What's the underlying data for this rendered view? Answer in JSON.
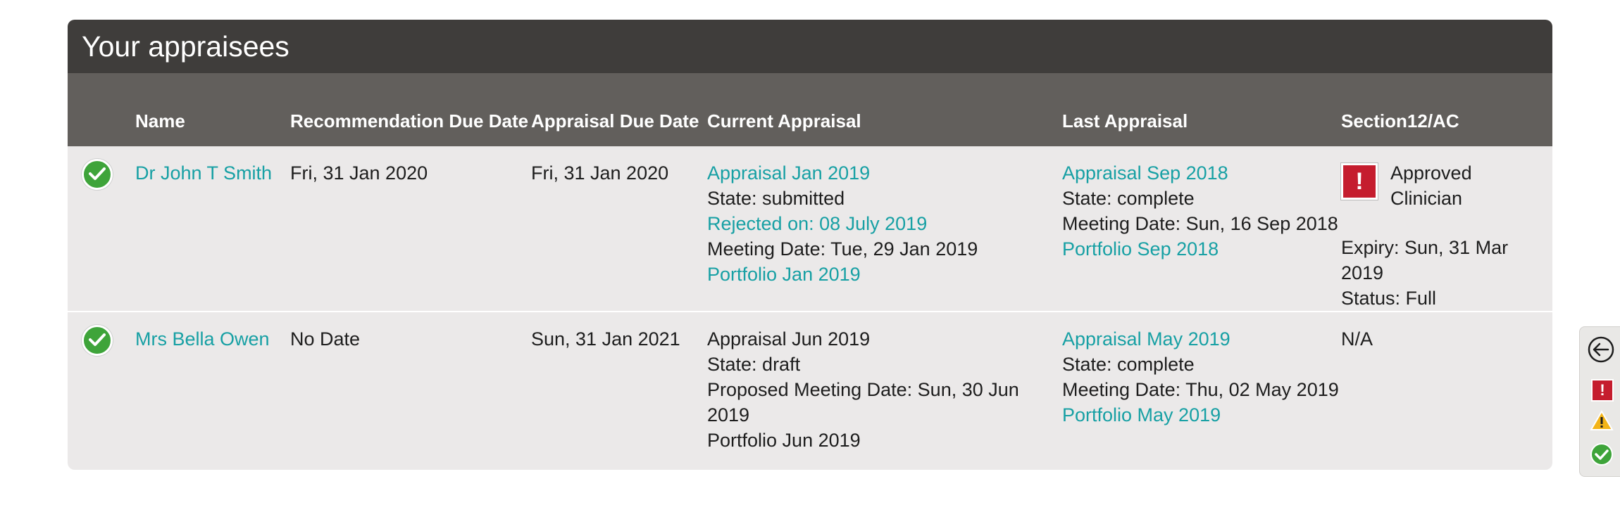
{
  "panel": {
    "title": "Your appraisees"
  },
  "columns": {
    "name": "Name",
    "rec_due": "Recommendation Due Date",
    "appraisal_due": "Appraisal Due Date",
    "current": "Current Appraisal",
    "last": "Last Appraisal",
    "section12": "Section12/AC"
  },
  "rows": [
    {
      "name": "Dr John T Smith",
      "rec_due": "Fri, 31 Jan 2020",
      "appraisal_due": "Fri, 31 Jan 2020",
      "current": {
        "title": "Appraisal Jan 2019",
        "state": "State: submitted",
        "rejected": "Rejected on: 08 July 2019",
        "meeting": "Meeting Date: Tue, 29 Jan 2019",
        "portfolio": "Portfolio Jan 2019"
      },
      "last": {
        "title": "Appraisal Sep 2018",
        "state": "State: complete",
        "meeting": "Meeting Date: Sun, 16 Sep 2018",
        "portfolio": "Portfolio Sep 2018"
      },
      "section12": {
        "status_text": "Approved Clinician",
        "expiry": "Expiry: Sun, 31 Mar 2019",
        "status": "Status: Full"
      }
    },
    {
      "name": "Mrs Bella Owen",
      "rec_due": "No Date",
      "appraisal_due": "Sun, 31 Jan 2021",
      "current": {
        "title": "Appraisal Jun 2019",
        "state": "State: draft",
        "meeting": "Proposed Meeting Date: Sun, 30 Jun 2019",
        "portfolio": "Portfolio Jun 2019"
      },
      "last": {
        "title": "Appraisal May 2019",
        "state": "State: complete",
        "meeting": "Meeting Date: Thu, 02 May 2019",
        "portfolio": "Portfolio May 2019"
      },
      "section12": {
        "value": "N/A"
      }
    }
  ],
  "icons": {
    "row_status": "check-circle-icon",
    "alert": "exclamation-icon",
    "alert_glyph": "!",
    "legend_back": "back-arrow-icon",
    "legend_error": "error-icon",
    "legend_warning": "warning-icon",
    "legend_ok": "check-circle-icon"
  },
  "colors": {
    "link": "#17a0a4",
    "header_dark": "#3f3d3b",
    "header_mid": "#625f5c",
    "row_bg": "#ebe9e9",
    "ok_green": "#3ea43a",
    "alert_red": "#c51d2e",
    "warn_amber": "#f3b417"
  }
}
